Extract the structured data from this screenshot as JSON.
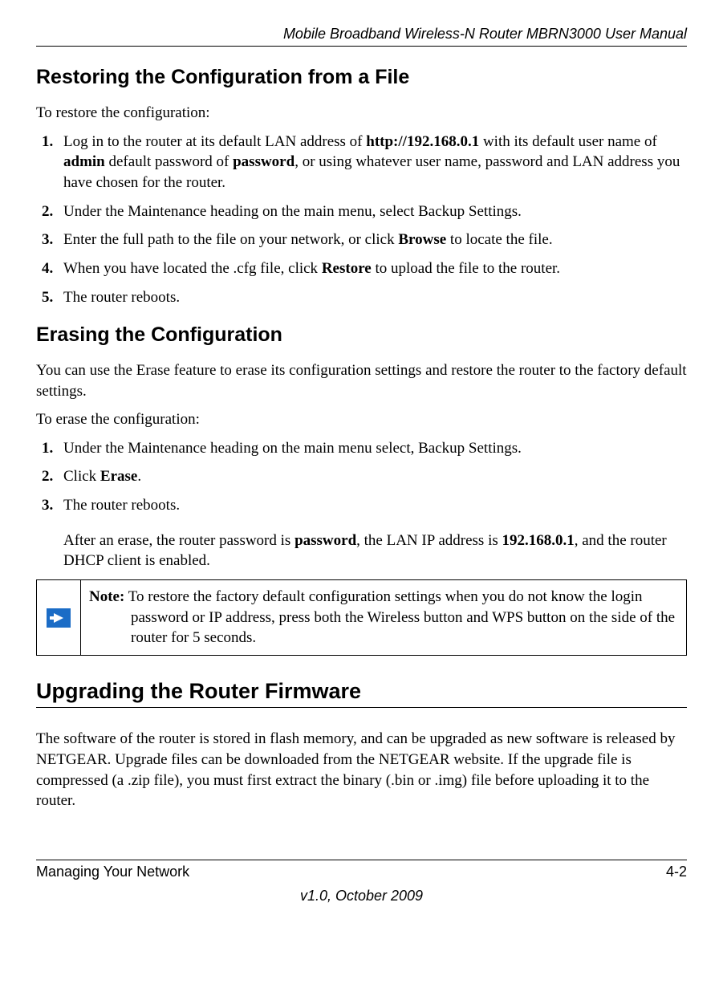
{
  "running_header": "Mobile Broadband Wireless-N Router MBRN3000 User Manual",
  "section1": {
    "heading": "Restoring the Configuration from a File",
    "intro": "To restore the configuration:",
    "steps": {
      "s1_a": "Log in to the router at its default LAN address of ",
      "s1_b": "http://192.168.0.1",
      "s1_c": " with its default user name of ",
      "s1_d": "admin",
      "s1_e": " default password of ",
      "s1_f": "password",
      "s1_g": ", or using whatever user name, password and LAN address you have chosen for the router.",
      "s2": "Under the Maintenance heading on the main menu, select Backup Settings.",
      "s3_a": "Enter the full path to the file on your network, or click ",
      "s3_b": "Browse",
      "s3_c": " to locate the file.",
      "s4_a": "When you have located the .cfg file, click ",
      "s4_b": "Restore",
      "s4_c": " to upload the file to the router.",
      "s5": "The router reboots."
    }
  },
  "section2": {
    "heading": "Erasing the Configuration",
    "para1": "You can use the Erase feature to erase its configuration settings and restore the router to the factory default settings.",
    "intro": "To erase the configuration:",
    "steps": {
      "s1": "Under the Maintenance heading on the main menu select, Backup Settings.",
      "s2_a": "Click ",
      "s2_b": "Erase",
      "s2_c": ".",
      "s3": "The router reboots."
    },
    "after_a": "After an erase, the router password is ",
    "after_b": "password",
    "after_c": ", the LAN IP address is ",
    "after_d": "192.168.0.1",
    "after_e": ", and the router DHCP client is enabled.",
    "note_label": "Note:",
    "note_body": " To restore the factory default configuration settings when you do not know the login password or IP address, press both the Wireless button and WPS button on the side of the router for 5 seconds."
  },
  "section3": {
    "heading": "Upgrading the Router Firmware",
    "para1": "The software of the router is stored in flash memory, and can be upgraded as new software is released by NETGEAR. Upgrade files can be downloaded from the NETGEAR website. If the upgrade file is compressed (a .zip file), you must first extract the binary (.bin or .img) file before uploading it to the router."
  },
  "footer": {
    "left": "Managing Your Network",
    "right": "4-2",
    "version": "v1.0, October 2009"
  }
}
